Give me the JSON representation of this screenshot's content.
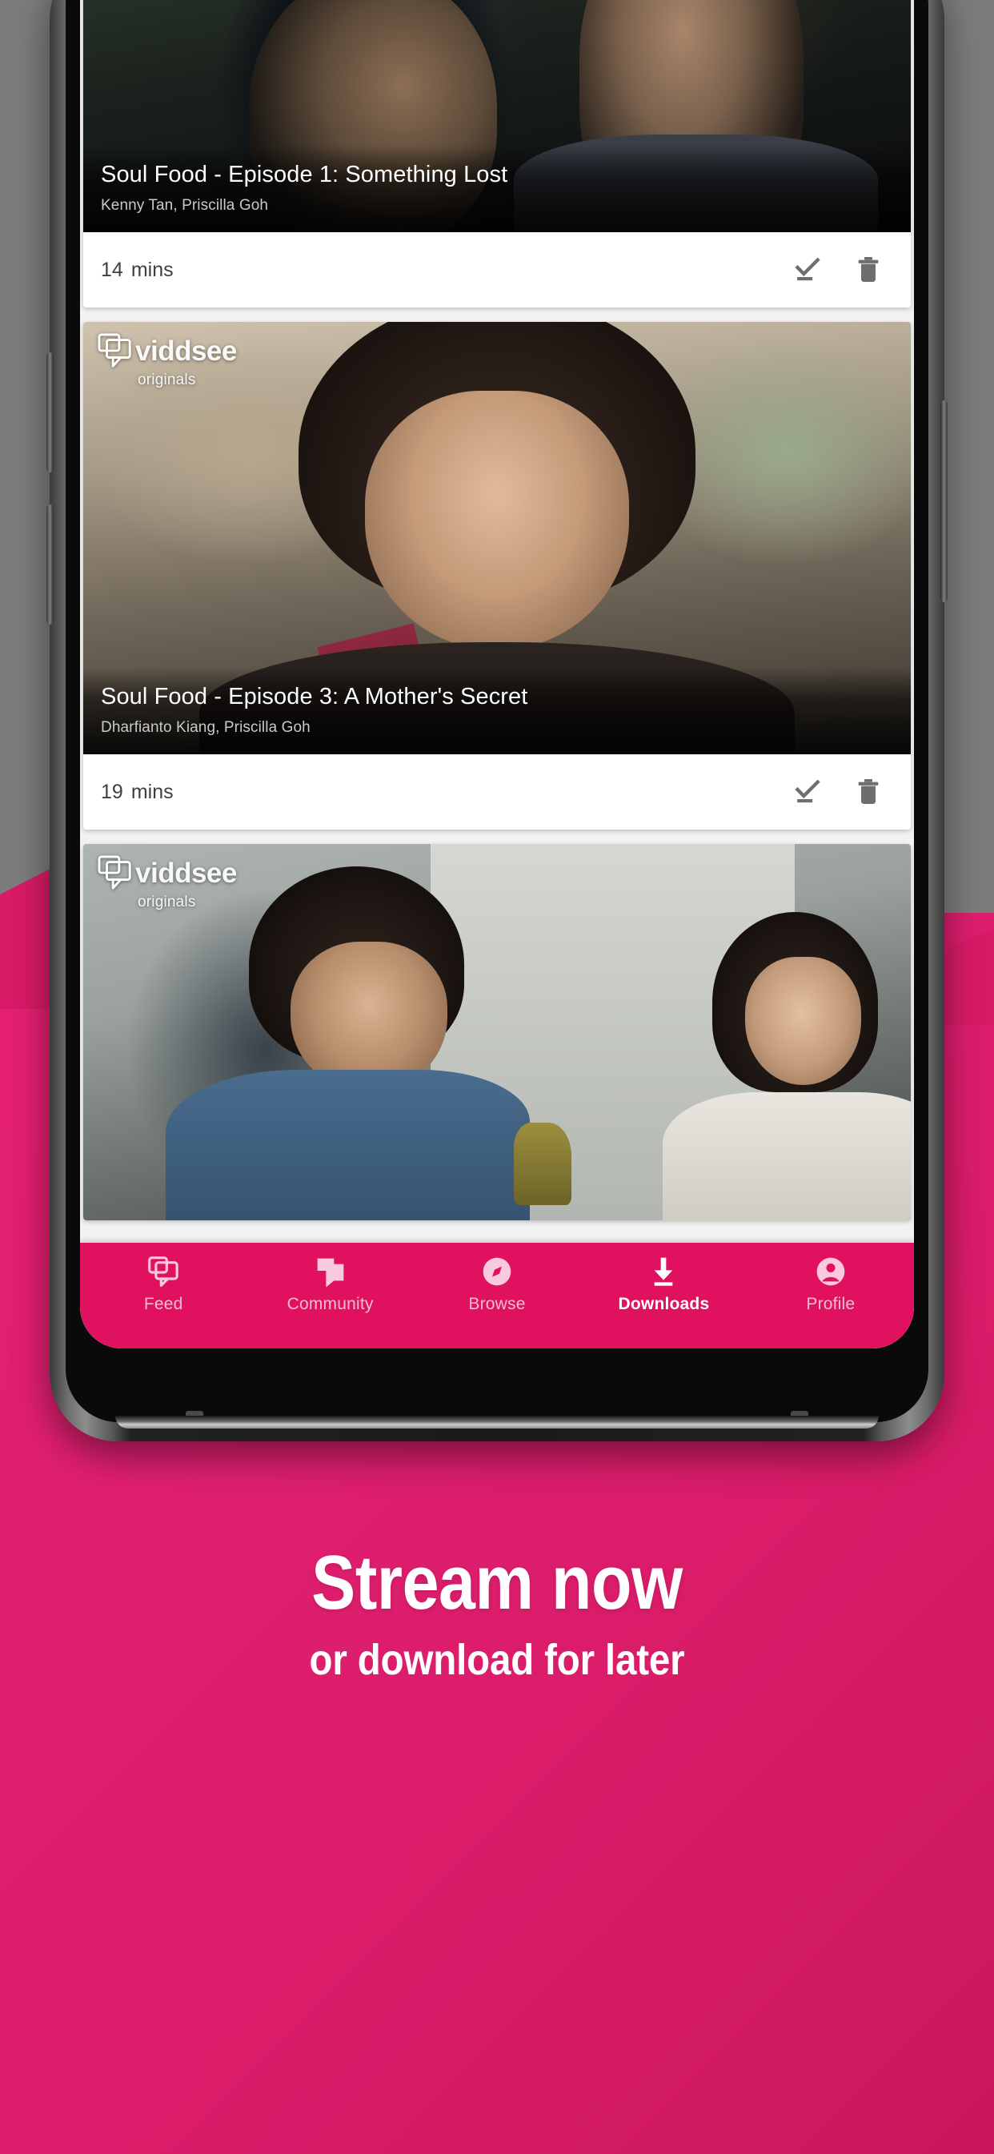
{
  "app": {
    "brand_watermark": {
      "name": "viddsee",
      "subtitle": "originals",
      "icon": "speech-bubble-icon"
    },
    "accent_color": "#e0115f",
    "background_color": "#7c7c7c"
  },
  "downloads_list": [
    {
      "title": "Soul Food - Episode 1: Something Lost",
      "creators": "Kenny Tan, Priscilla Goh",
      "duration_value": "14",
      "duration_unit": "mins",
      "downloaded_icon": "download-done-icon",
      "delete_icon": "trash-icon"
    },
    {
      "title": "Soul Food - Episode 3: A Mother's Secret",
      "creators": "Dharfianto Kiang, Priscilla Goh",
      "duration_value": "19",
      "duration_unit": "mins",
      "downloaded_icon": "download-done-icon",
      "delete_icon": "trash-icon"
    },
    {
      "title": "",
      "creators": "",
      "duration_value": "",
      "duration_unit": "",
      "downloaded_icon": "download-done-icon",
      "delete_icon": "trash-icon"
    }
  ],
  "bottom_nav": {
    "active_index": 3,
    "items": [
      {
        "label": "Feed",
        "icon": "feed-bubble-icon"
      },
      {
        "label": "Community",
        "icon": "community-chat-icon"
      },
      {
        "label": "Browse",
        "icon": "compass-icon"
      },
      {
        "label": "Downloads",
        "icon": "download-arrow-icon"
      },
      {
        "label": "Profile",
        "icon": "person-circle-icon"
      }
    ]
  },
  "marketing": {
    "headline": "Stream now",
    "subhead": "or download for later"
  }
}
